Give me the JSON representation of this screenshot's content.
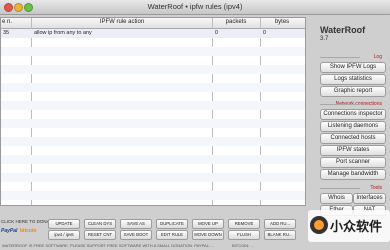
{
  "window": {
    "title": "WaterRoof • ipfw rules (ipv4)"
  },
  "table": {
    "columns": [
      "e n.",
      "IPFW rule action",
      "packets",
      "bytes"
    ],
    "rows": [
      {
        "rule_no": "35",
        "action": "allow ip from any to any",
        "packets": "0",
        "bytes": "0"
      }
    ]
  },
  "buttons": {
    "donate_label": "CLICK HERE TO DONATE:",
    "paypal": "PayPal",
    "bitcoin": "bitcoin",
    "row1": [
      "UPDATE",
      "CLEAN DYS",
      "SAVE AS",
      "DUPLICATE",
      "MOVE UP",
      "REMOVE",
      "ADD RU..."
    ],
    "row2": [
      "ipv4 / ipv6",
      "RESET CNT",
      "SAVE BOOT",
      "EDIT RULE",
      "MOVE DOWN",
      "FLUSH",
      "BLANK RU..."
    ]
  },
  "footer": {
    "left": "WATERROOF IS FREE SOFTWARE. PLEASE SUPPORT FREE SOFTWARE WITH A SMALL DONATION. PAYPAL: ...",
    "right": "BITCOIN: ..."
  },
  "sidebar": {
    "app_name": "WaterRoof",
    "version": "3.7",
    "log_section": "Log",
    "log_buttons": [
      "Show IPFW Logs",
      "Logs statistics",
      "Graphic report"
    ],
    "network_section": "Network connections",
    "network_buttons": [
      "Connections inspector",
      "Listening daemons",
      "Connected hosts",
      "IPFW states",
      "Port scanner",
      "Manage bandwidth"
    ],
    "tools_section": "Tools",
    "tools_buttons": [
      "Whois",
      "Interfaces",
      "Ether",
      "NAT"
    ]
  },
  "watermark": {
    "text": "小众软件"
  }
}
